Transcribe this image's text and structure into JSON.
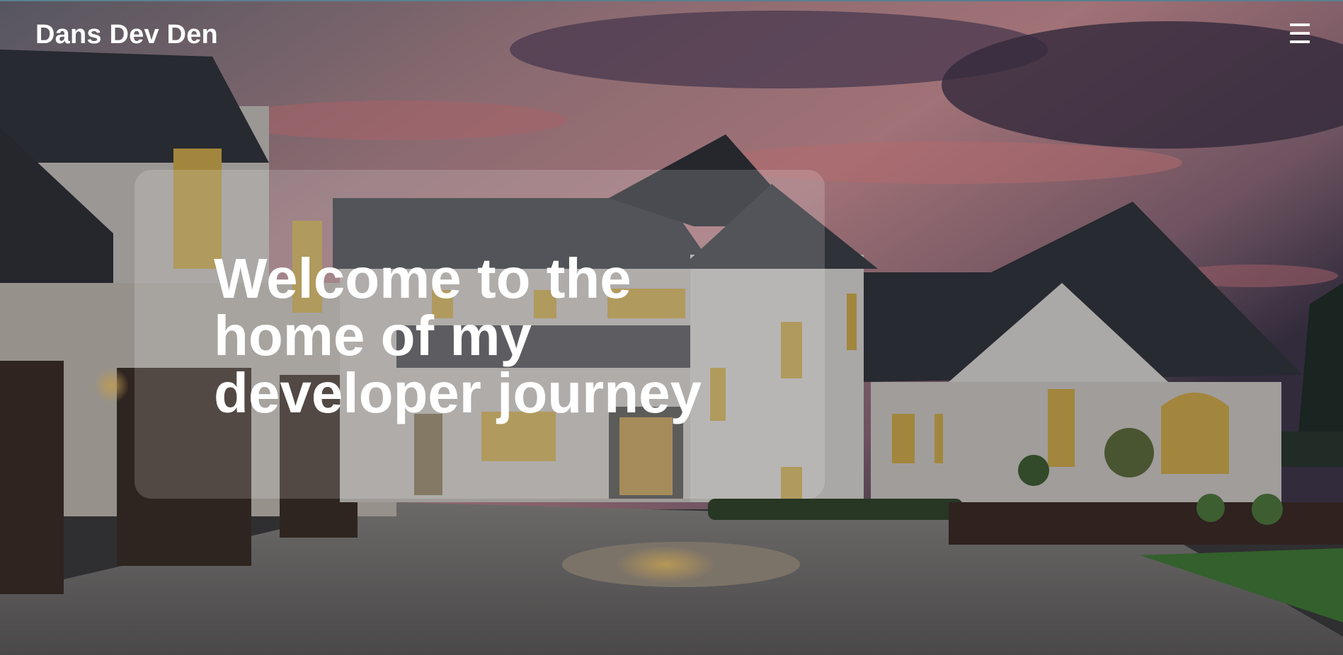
{
  "header": {
    "brand": "Dans Dev Den",
    "menu_icon": "hamburger-menu-icon",
    "menu_glyph": "☰"
  },
  "hero": {
    "background_image": "house-at-dusk-photo",
    "headline": "Welcome to the home of my developer journey"
  },
  "colors": {
    "text": "#ffffff",
    "card": "rgba(255,255,255,0.17)",
    "sky_pink": "#e08a8c",
    "sky_purple": "#5b4662"
  }
}
